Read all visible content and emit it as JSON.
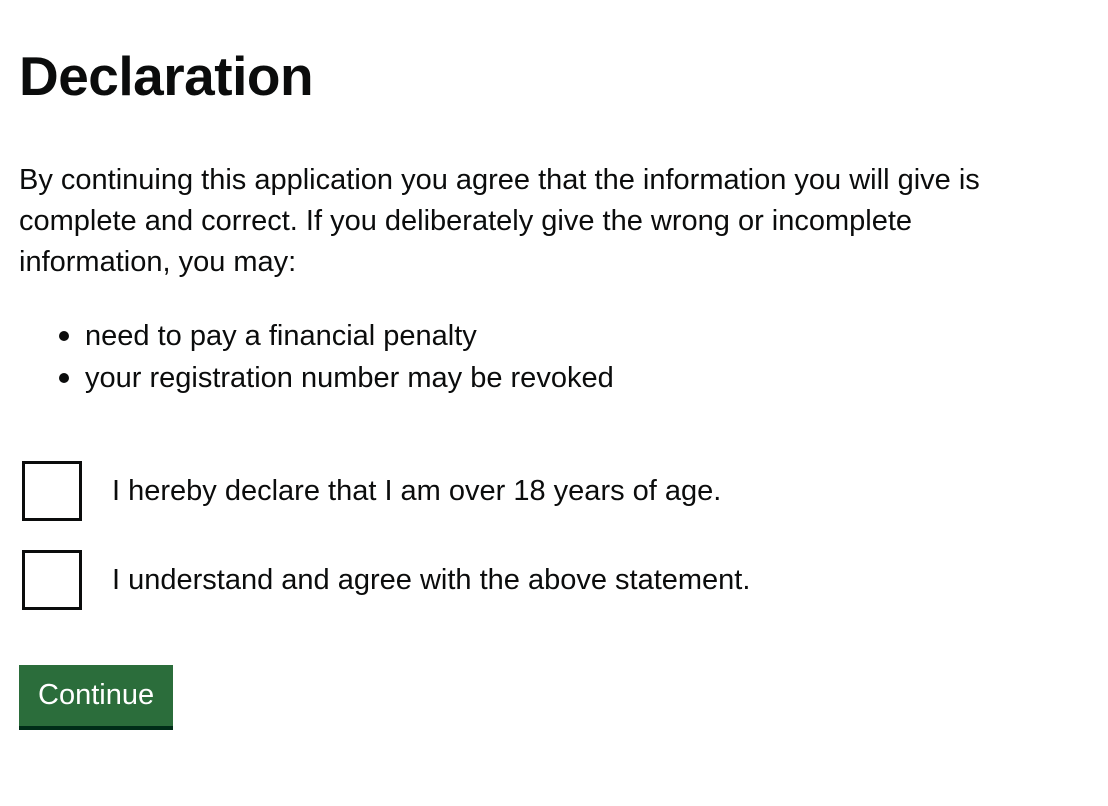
{
  "page": {
    "heading": "Declaration",
    "intro": "By continuing this application you agree that the information you will give is complete and correct. If you deliberately give the wrong or incomplete information, you may:",
    "consequences": [
      "need to pay a financial penalty",
      "your registration number may be revoked"
    ]
  },
  "declarations": [
    {
      "label": "I hereby declare that I am over 18 years of age.",
      "checked": false
    },
    {
      "label": "I understand and agree with the above statement.",
      "checked": false
    }
  ],
  "actions": {
    "continue_label": "Continue"
  },
  "colors": {
    "text": "#0b0c0c",
    "button_bg": "#2b6d3b",
    "button_shadow": "#002d18",
    "button_text": "#ffffff"
  }
}
